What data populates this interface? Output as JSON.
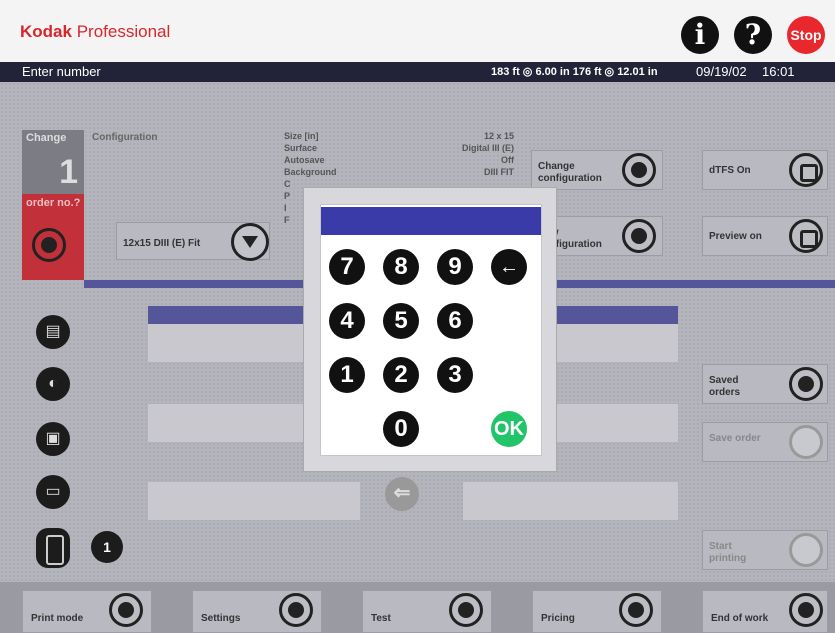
{
  "header": {
    "brand_kodak": "Kodak",
    "brand_professional": "Professional",
    "info_symbol": "i",
    "help_symbol": "?",
    "stop_label": "Stop"
  },
  "status": {
    "prompt": "Enter number",
    "media_info": "183 ft ◎ 6.00 in   176 ft ◎ 12.01 in",
    "date": "09/19/02",
    "time": "16:01"
  },
  "order_panel": {
    "change_label": "Change",
    "change_number": "1",
    "order_label": "order no.?"
  },
  "configuration": {
    "label": "Configuration",
    "rows": [
      {
        "key": "Size [in]",
        "value": "12 x 15"
      },
      {
        "key": "Surface",
        "value": "Digital III (E)"
      },
      {
        "key": "Autosave",
        "value": "Off"
      },
      {
        "key": "Background",
        "value": "DIII FIT"
      },
      {
        "key": "C",
        "value": ""
      },
      {
        "key": "P",
        "value": ""
      },
      {
        "key": "I",
        "value": ""
      },
      {
        "key": "F",
        "value": ""
      }
    ],
    "dropdown_value": "12x15 DIII (E) Fit"
  },
  "right_buttons": {
    "change_configuration": "Change configuration",
    "new_configuration": "New configuration",
    "dtfs": "dTFS On",
    "preview": "Preview on",
    "saved_orders": "Saved orders",
    "save_order": "Save order",
    "start_printing": "Start printing"
  },
  "order_count": "1",
  "bottom_nav": [
    {
      "label": "Print mode"
    },
    {
      "label": "Settings"
    },
    {
      "label": "Test"
    },
    {
      "label": "Pricing"
    },
    {
      "label": "End of work"
    }
  ],
  "keypad": {
    "input_value": "",
    "keys": [
      "7",
      "8",
      "9",
      "4",
      "5",
      "6",
      "1",
      "2",
      "3",
      "0"
    ],
    "backspace": "←",
    "ok": "OK"
  },
  "colors": {
    "brand_red": "#d8262c",
    "stop_red": "#e8282d",
    "status_bar": "#222238",
    "accent_blue": "#55559a",
    "ok_green": "#22c46a"
  }
}
